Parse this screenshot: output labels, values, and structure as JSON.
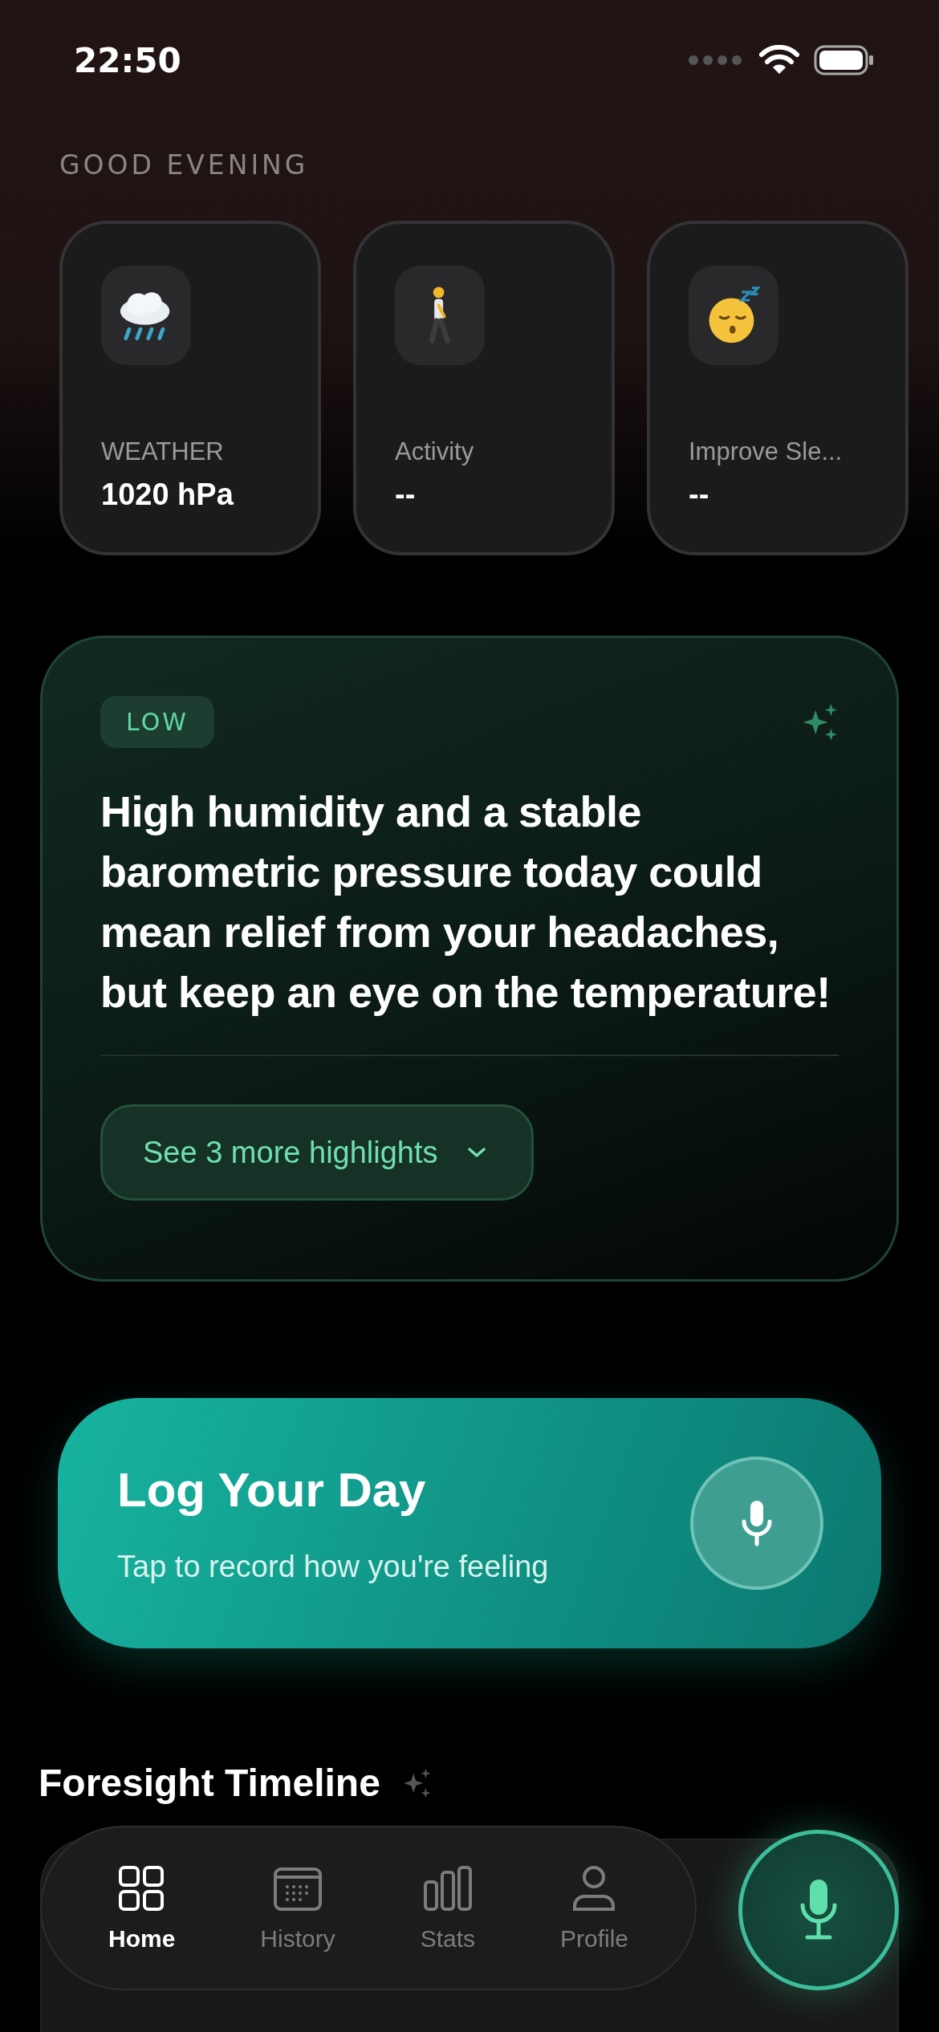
{
  "status_bar": {
    "time": "22:50"
  },
  "greeting": "GOOD EVENING",
  "cards": [
    {
      "kind": "weather",
      "label": "WEATHER",
      "value": "1020 hPa"
    },
    {
      "kind": "activity",
      "label": "Activity",
      "value": "--"
    },
    {
      "kind": "sleep",
      "label": "Improve Sle...",
      "value": "--"
    }
  ],
  "insight": {
    "risk_badge": "LOW",
    "text": "High humidity and a stable barometric pressure today could mean relief from your headaches, but keep an eye on the temperature!",
    "highlights_button": "See 3 more highlights"
  },
  "log_card": {
    "title": "Log Your Day",
    "subtitle": "Tap to record how you're feeling"
  },
  "timeline": {
    "title": "Foresight Timeline"
  },
  "tab_bar": {
    "tabs": [
      {
        "kind": "home",
        "label": "Home",
        "selected": true
      },
      {
        "kind": "history",
        "label": "History",
        "selected": false
      },
      {
        "kind": "stats",
        "label": "Stats",
        "selected": false
      },
      {
        "kind": "profile",
        "label": "Profile",
        "selected": false
      }
    ]
  }
}
